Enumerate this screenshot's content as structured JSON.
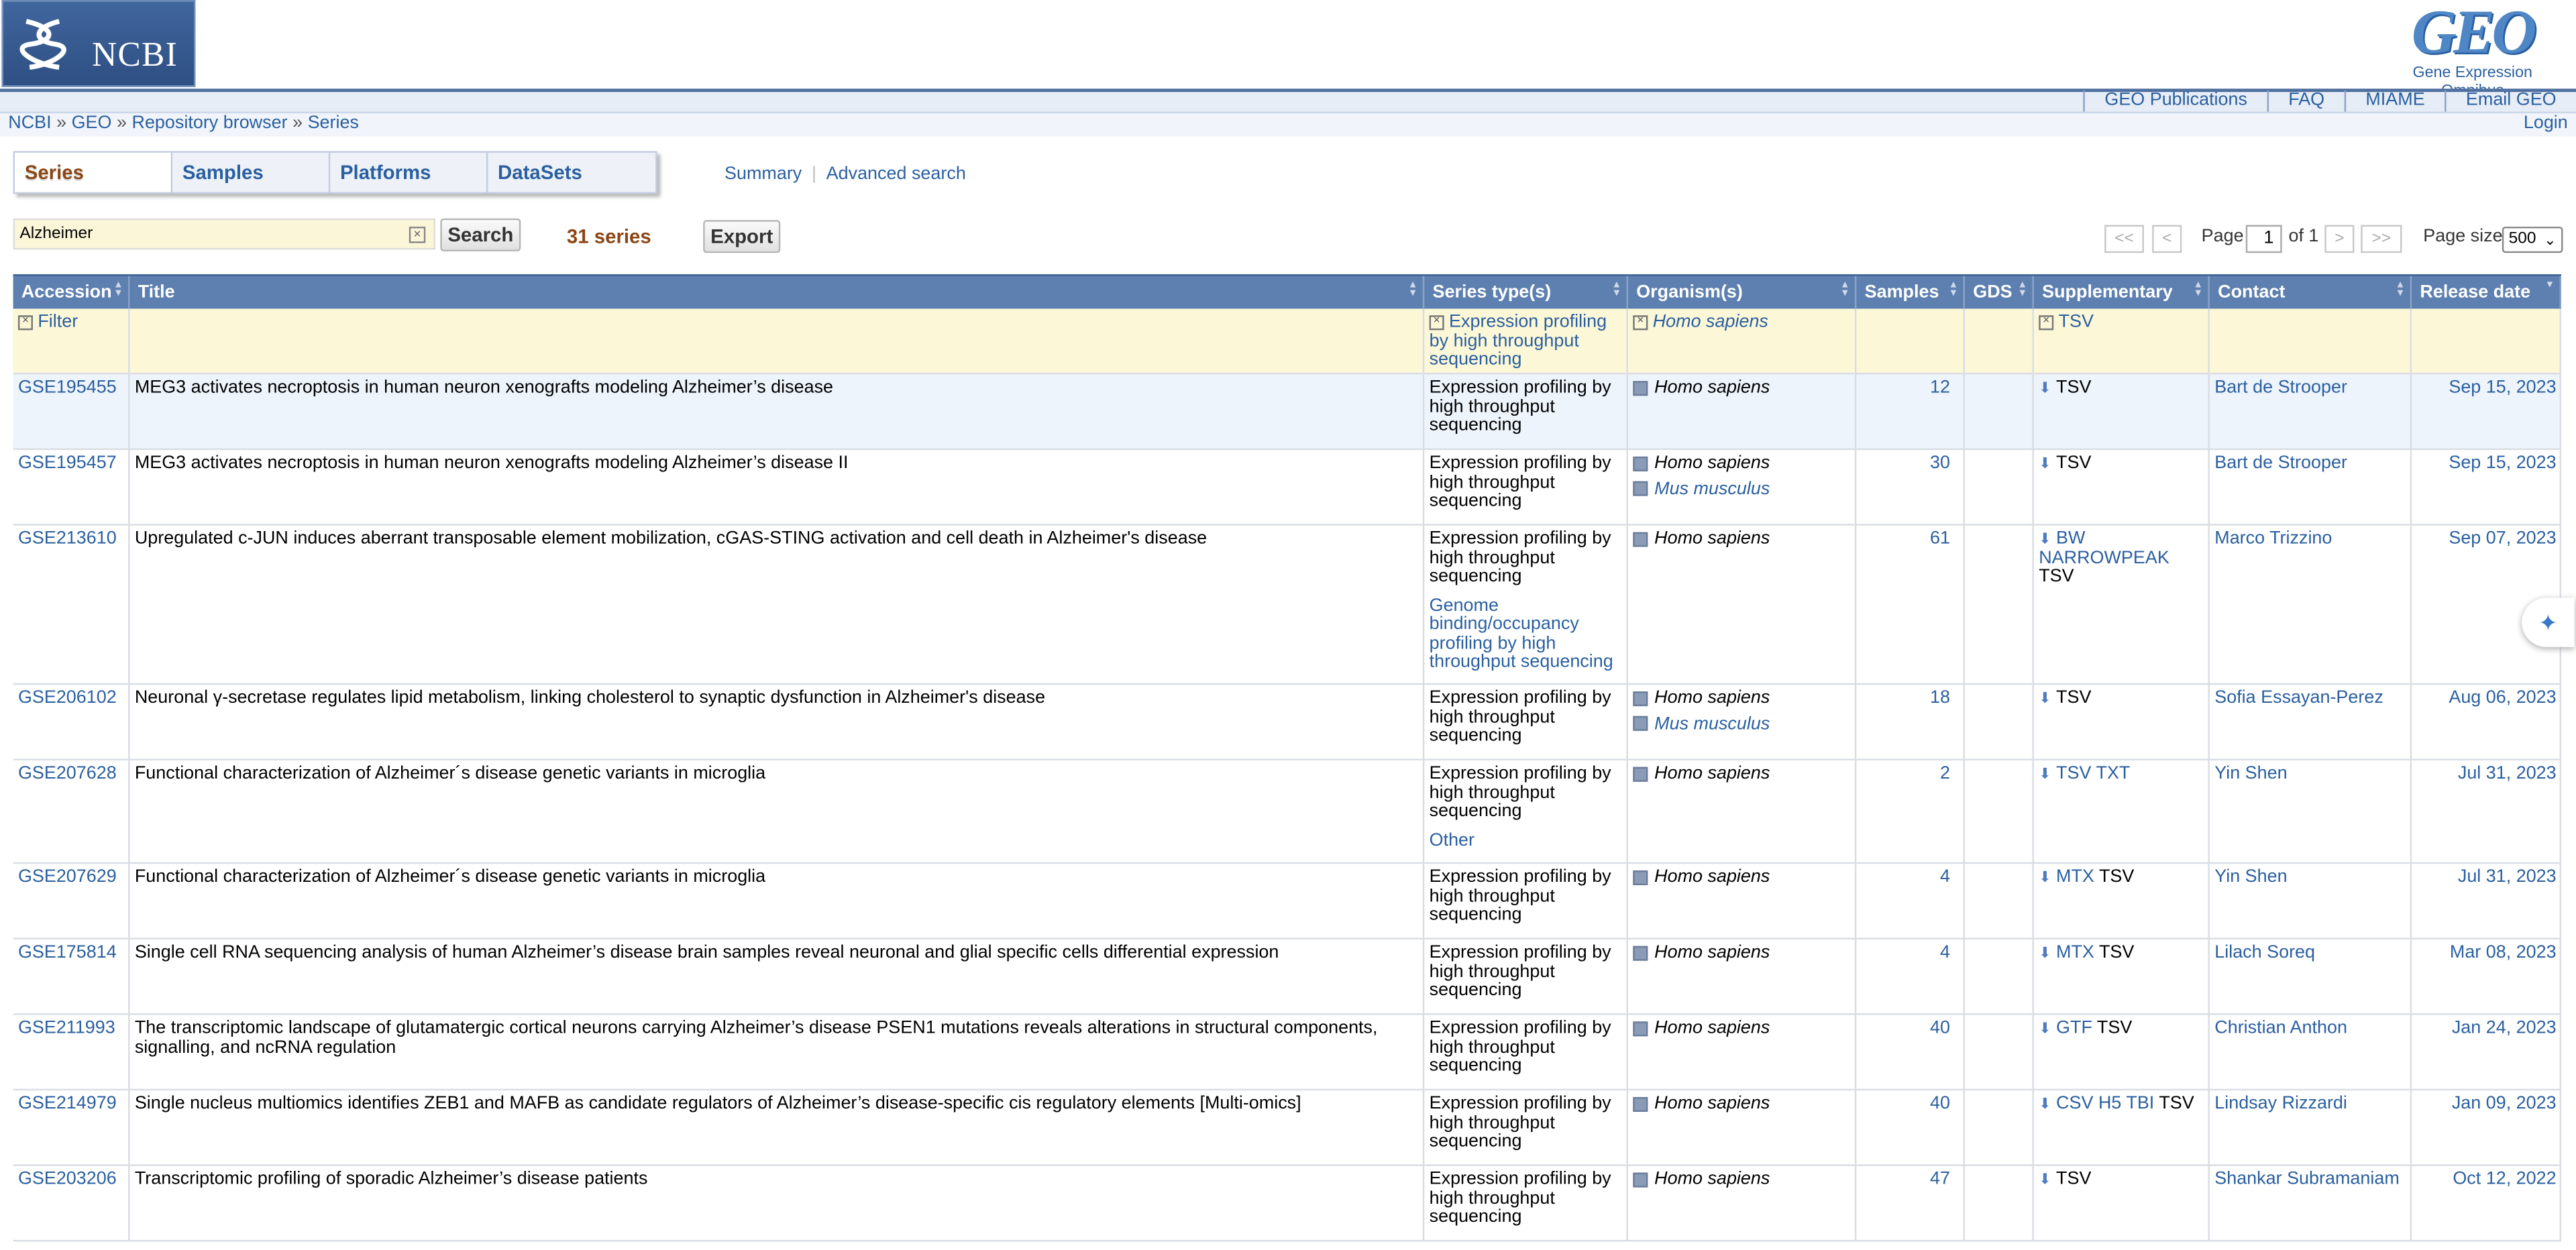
{
  "header": {
    "ncbi_label": "NCBI",
    "geo_big": "GEO",
    "geo_small": "Gene Expression Omnibus"
  },
  "topnav": [
    "GEO Publications",
    "FAQ",
    "MIAME",
    "Email GEO"
  ],
  "breadcrumb": [
    "NCBI",
    "GEO",
    "Repository browser",
    "Series"
  ],
  "breadcrumb_sep": "»",
  "login": "Login",
  "tabs": [
    "Series",
    "Samples",
    "Platforms",
    "DataSets"
  ],
  "links": {
    "summary": "Summary",
    "advanced": "Advanced search"
  },
  "search": {
    "value": "Alzheimer",
    "button": "Search",
    "count": "31 series",
    "export": "Export"
  },
  "pager": {
    "first": "<<",
    "prev": "<",
    "page_label": "Page",
    "page": "1",
    "of": "of 1",
    "next": ">",
    "last": ">>",
    "size_label": "Page size",
    "size": "500"
  },
  "columns": [
    "Accession",
    "Title",
    "Series type(s)",
    "Organism(s)",
    "Samples",
    "GDS",
    "Supplementary",
    "Contact",
    "Release date"
  ],
  "filter": {
    "label": "Filter",
    "series_type": "Expression profiling by high throughput sequencing",
    "organism": "Homo sapiens",
    "supplementary": "TSV"
  },
  "rows": [
    {
      "acc": "GSE195455",
      "title": "MEG3 activates necroptosis in human neuron xenografts modeling Alzheimer’s disease",
      "types": [
        "Expression profiling by high throughput sequencing"
      ],
      "orgs": [
        "Homo sapiens"
      ],
      "samples": "12",
      "supp": [
        "TSV"
      ],
      "contact": "Bart de Strooper",
      "date": "Sep 15, 2023"
    },
    {
      "acc": "GSE195457",
      "title": "MEG3 activates necroptosis in human neuron xenografts modeling Alzheimer’s disease II",
      "types": [
        "Expression profiling by high throughput sequencing"
      ],
      "orgs": [
        "Homo sapiens",
        "Mus musculus"
      ],
      "samples": "30",
      "supp": [
        "TSV"
      ],
      "contact": "Bart de Strooper",
      "date": "Sep 15, 2023"
    },
    {
      "acc": "GSE213610",
      "title": "Upregulated c-JUN induces aberrant transposable element mobilization, cGAS-STING activation and cell death in Alzheimer's disease",
      "types": [
        "Expression profiling by high throughput sequencing",
        "Genome binding/occupancy profiling by high throughput sequencing"
      ],
      "orgs": [
        "Homo sapiens"
      ],
      "samples": "61",
      "supp": [
        "BW",
        "NARROWPEAK",
        "TSV"
      ],
      "contact": "Marco Trizzino",
      "date": "Sep 07, 2023"
    },
    {
      "acc": "GSE206102",
      "title": "Neuronal γ-secretase regulates lipid metabolism, linking cholesterol to synaptic dysfunction in Alzheimer's disease",
      "types": [
        "Expression profiling by high throughput sequencing"
      ],
      "orgs": [
        "Homo sapiens",
        "Mus musculus"
      ],
      "samples": "18",
      "supp": [
        "TSV"
      ],
      "contact": "Sofia Essayan-Perez",
      "date": "Aug 06, 2023"
    },
    {
      "acc": "GSE207628",
      "title": "Functional characterization of Alzheimer´s disease genetic variants in microglia",
      "types": [
        "Expression profiling by high throughput sequencing",
        "Other"
      ],
      "orgs": [
        "Homo sapiens"
      ],
      "samples": "2",
      "supp": [
        "TSV",
        "TXT"
      ],
      "contact": "Yin Shen",
      "date": "Jul 31, 2023"
    },
    {
      "acc": "GSE207629",
      "title": "Functional characterization of Alzheimer´s disease genetic variants in microglia",
      "types": [
        "Expression profiling by high throughput sequencing"
      ],
      "orgs": [
        "Homo sapiens"
      ],
      "samples": "4",
      "supp": [
        "MTX",
        "TSV"
      ],
      "contact": "Yin Shen",
      "date": "Jul 31, 2023"
    },
    {
      "acc": "GSE175814",
      "title": "Single cell RNA sequencing analysis of human Alzheimer’s disease brain samples reveal neuronal and glial specific cells differential expression",
      "types": [
        "Expression profiling by high throughput sequencing"
      ],
      "orgs": [
        "Homo sapiens"
      ],
      "samples": "4",
      "supp": [
        "MTX",
        "TSV"
      ],
      "contact": "Lilach Soreq",
      "date": "Mar 08, 2023"
    },
    {
      "acc": "GSE211993",
      "title": "The transcriptomic landscape of glutamatergic cortical neurons carrying Alzheimer’s disease PSEN1 mutations reveals alterations in structural components, signalling, and ncRNA regulation",
      "types": [
        "Expression profiling by high throughput sequencing"
      ],
      "orgs": [
        "Homo sapiens"
      ],
      "samples": "40",
      "supp": [
        "GTF",
        "TSV"
      ],
      "contact": "Christian Anthon",
      "date": "Jan 24, 2023"
    },
    {
      "acc": "GSE214979",
      "title": "Single nucleus multiomics identifies ZEB1 and MAFB as candidate regulators of Alzheimer’s disease-specific cis regulatory elements [Multi-omics]",
      "types": [
        "Expression profiling by high throughput sequencing"
      ],
      "orgs": [
        "Homo sapiens"
      ],
      "samples": "40",
      "supp": [
        "CSV",
        "H5",
        "TBI",
        "TSV"
      ],
      "contact": "Lindsay Rizzardi",
      "date": "Jan 09, 2023"
    },
    {
      "acc": "GSE203206",
      "title": "Transcriptomic profiling of sporadic Alzheimer’s disease patients",
      "types": [
        "Expression profiling by high throughput sequencing"
      ],
      "orgs": [
        "Homo sapiens"
      ],
      "samples": "47",
      "supp": [
        "TSV"
      ],
      "contact": "Shankar Subramaniam",
      "date": "Oct 12, 2022"
    }
  ]
}
